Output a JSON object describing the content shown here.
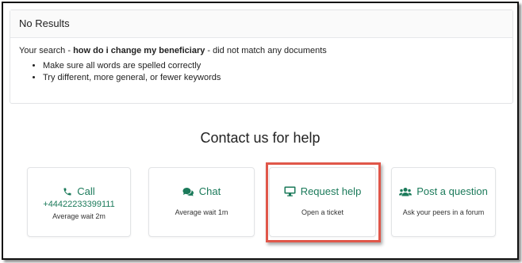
{
  "results": {
    "header": "No Results",
    "search_prefix": "Your search - ",
    "search_query": "how do i change my beneficiary",
    "search_suffix": " - did not match any documents",
    "tips": [
      "Make sure all words are spelled correctly",
      "Try different, more general, or fewer keywords"
    ]
  },
  "contact": {
    "title": "Contact us for help",
    "tiles": [
      {
        "label": "Call",
        "icon": "phone-icon",
        "phone": "+44422233399111",
        "sub": "Average wait 2m"
      },
      {
        "label": "Chat",
        "icon": "chat-bubbles-icon",
        "sub": "Average wait 1m"
      },
      {
        "label": "Request help",
        "icon": "monitor-icon",
        "sub": "Open a ticket"
      },
      {
        "label": "Post a question",
        "icon": "users-icon",
        "sub": "Ask your peers in a forum"
      }
    ]
  },
  "colors": {
    "accent": "#1b7a5a",
    "highlight": "#e0574a"
  }
}
